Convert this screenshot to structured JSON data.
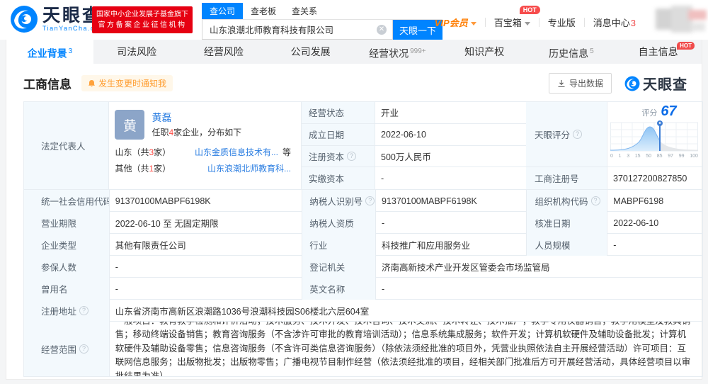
{
  "colors": {
    "accent": "#0084ff",
    "red": "#f04b4b",
    "orange": "#ff9c2e"
  },
  "header": {
    "logo_title": "天眼查",
    "logo_domain": "TianYanCha.com",
    "badge_line1": "国家中小企业发展子基金旗下",
    "badge_line2": "官方备案企业征信机构",
    "search": {
      "tabs": [
        {
          "label": "查公司"
        },
        {
          "label": "查老板"
        },
        {
          "label": "查关系"
        }
      ],
      "value": "山东浪潮北师教育科技有限公司",
      "button": "天眼一下"
    },
    "menu": {
      "vip": "VIP会员",
      "toolbox": "百宝箱",
      "toolbox_badge": "HOT",
      "pro": "专业版",
      "messages": "消息中心",
      "messages_count": "3"
    }
  },
  "nav": {
    "tabs": [
      {
        "label": "企业背景",
        "count": "3"
      },
      {
        "label": "司法风险"
      },
      {
        "label": "经营风险"
      },
      {
        "label": "公司发展"
      },
      {
        "label": "经营状况",
        "count": "999+"
      },
      {
        "label": "知识产权"
      },
      {
        "label": "历史信息",
        "count": "5"
      },
      {
        "label": "自主信息",
        "badge": "HOT"
      }
    ]
  },
  "section": {
    "title": "工商信息",
    "notify_badge": "发生变更时通知我",
    "export_button": "导出数据",
    "watermark": "天眼查"
  },
  "legal_rep": {
    "label": "法定代表人",
    "avatar_char": "黄",
    "name": "黄磊",
    "job_prefix": "任职",
    "job_count": "4",
    "job_suffix": "家企业，分布如下",
    "dist": [
      {
        "region_pre": "山东（共",
        "num": "3",
        "region_post": "家）",
        "company": "山东金质信息技术有...",
        "extra": "等"
      },
      {
        "region_pre": "其他（共",
        "num": "1",
        "region_post": "家）",
        "company": "山东浪潮北师教育科...",
        "extra": ""
      }
    ]
  },
  "score": {
    "label": "天眼评分",
    "title": "评分",
    "value": "67",
    "ticks": [
      "0",
      "1",
      "3",
      "15",
      "50",
      "85",
      "97",
      "99",
      "100"
    ]
  },
  "fields": {
    "status": {
      "label": "经营状态",
      "value": "开业"
    },
    "est_date": {
      "label": "成立日期",
      "value": "2022-06-10"
    },
    "reg_capital": {
      "label": "注册资本",
      "value": "500万人民币"
    },
    "paid_capital": {
      "label": "实缴资本",
      "value": "-"
    },
    "reg_number": {
      "label": "工商注册号",
      "value": "370127200827850"
    },
    "credit_code": {
      "label": "统一社会信用代码",
      "value": "91370100MABPF6198K"
    },
    "taxpayer_id": {
      "label": "纳税人识别号",
      "value": "91370100MABPF6198K"
    },
    "org_code": {
      "label": "组织机构代码",
      "value": "MABPF6198"
    },
    "business_term": {
      "label": "营业期限",
      "value": "2022-06-10 至 无固定期限"
    },
    "taxpayer_quality": {
      "label": "纳税人资质",
      "value": "-"
    },
    "approval_date": {
      "label": "核准日期",
      "value": "2022-06-10"
    },
    "company_type": {
      "label": "企业类型",
      "value": "其他有限责任公司"
    },
    "industry": {
      "label": "行业",
      "value": "科技推广和应用服务业"
    },
    "staff_size": {
      "label": "人员规模",
      "value": "-"
    },
    "insured_count": {
      "label": "参保人数",
      "value": "-"
    },
    "registry": {
      "label": "登记机关",
      "value": "济南高新技术产业开发区管委会市场监管局"
    },
    "former_name": {
      "label": "曾用名",
      "value": "-"
    },
    "english_name": {
      "label": "英文名称",
      "value": "-"
    },
    "address": {
      "label": "注册地址",
      "value": "山东省济南市高新区浪潮路1036号浪潮科技园S06楼北六层604室"
    },
    "business_scope": {
      "label": "经营范围",
      "value": "一般项目：教育教学检测和评价活动；技术服务、技术开发、技术咨询、技术交流、技术转让、技术推广；教学专用仪器销售；教学用模型及教具销售；移动终端设备销售；教育咨询服务（不含涉许可审批的教育培训活动）；信息系统集成服务；软件开发；计算机软硬件及辅助设备批发；计算机软硬件及辅助设备零售；信息咨询服务（不含许可类信息咨询服务）（除依法须经批准的项目外，凭营业执照依法自主开展经营活动）许可项目：互联网信息服务；出版物批发；出版物零售；广播电视节目制作经营（依法须经批准的项目，经相关部门批准后方可开展经营活动，具体经营项目以审批结果为准）"
    }
  }
}
